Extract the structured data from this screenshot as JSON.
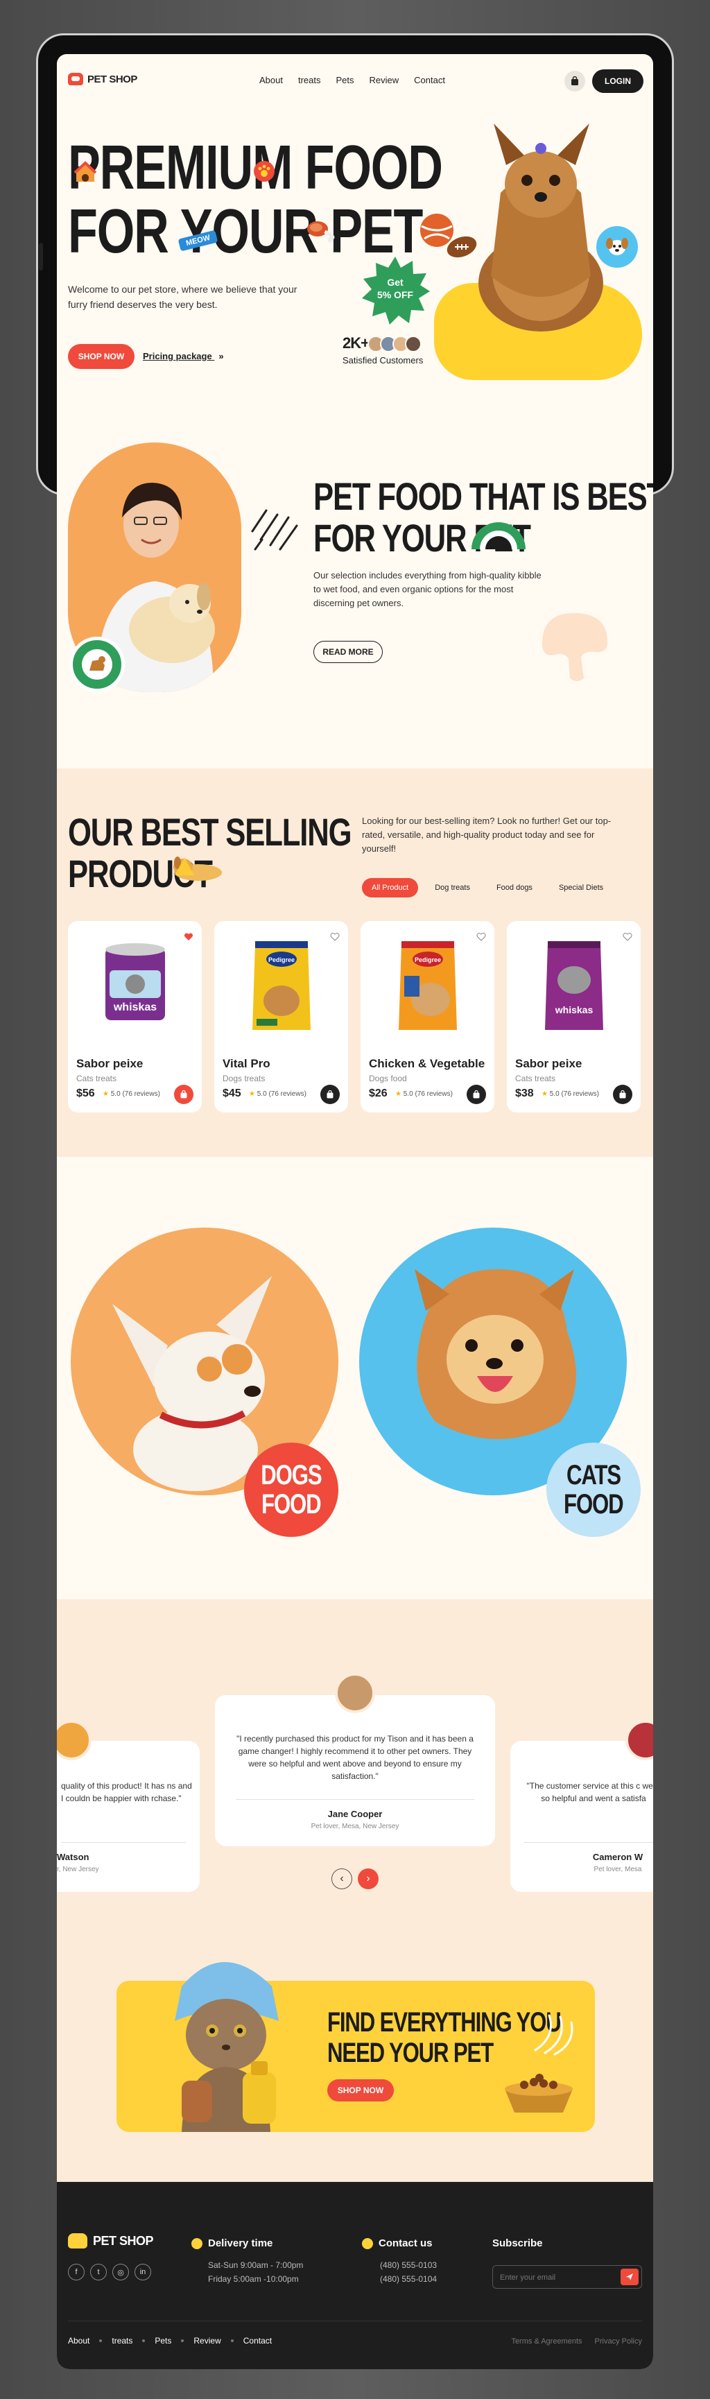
{
  "brand": {
    "name": "PET SHOP",
    "accent": "#ef4a3b",
    "yellow": "#ffd22e",
    "dark": "#1c1c1c"
  },
  "nav": {
    "links": [
      "About",
      "treats",
      "Pets",
      "Review",
      "Contact"
    ],
    "login": "LOGIN",
    "cart_icon": "shopping-bag-icon"
  },
  "hero": {
    "title_line1": "PREMIUM FOOD",
    "title_line2": "FOR YOUR PET",
    "tag": "MEOW",
    "description": "Welcome to our pet store, where we believe that your furry friend deserves the very best.",
    "cta": "SHOP NOW",
    "pricing_link": "Pricing package",
    "offer_line1": "Get",
    "offer_line2": "5% OFF",
    "customers_count": "2K+",
    "customers_label": "Satisfied Customers"
  },
  "about": {
    "title_line1": "PET FOOD THAT IS BEST",
    "title_line2": "FOR YOUR PET",
    "description": "Our selection includes everything from high-quality kibble to wet food, and even organic options for the most discerning pet owners.",
    "button": "READ MORE"
  },
  "products": {
    "title_line1": "OUR BEST SELLING",
    "title_line2": "PRODUCT",
    "description": "Looking for our best-selling item? Look no further! Get our top-rated, versatile, and high-quality product today and see for yourself!",
    "filters": [
      "All Product",
      "Dog treats",
      "Food dogs",
      "Special Diets"
    ],
    "active_filter": "All Product",
    "items": [
      {
        "name": "Sabor peixe",
        "category": "Cats treats",
        "price": "$56",
        "rating": "5.0",
        "reviews": "(76 reviews)",
        "brand": "whiskas",
        "liked": true
      },
      {
        "name": "Vital Pro",
        "category": "Dogs treats",
        "price": "$45",
        "rating": "5.0",
        "reviews": "(76 reviews)",
        "brand": "Pedigree",
        "liked": false
      },
      {
        "name": "Chicken & Vegetable",
        "category": "Dogs food",
        "price": "$26",
        "rating": "5.0",
        "reviews": "(76 reviews)",
        "brand": "Pedigree",
        "liked": false
      },
      {
        "name": "Sabor peixe",
        "category": "Cats treats",
        "price": "$38",
        "rating": "5.0",
        "reviews": "(76 reviews)",
        "brand": "whiskas",
        "liked": false
      }
    ]
  },
  "categories": {
    "dogs_line1": "DOGS",
    "dogs_line2": "FOOD",
    "cats_line1": "CATS",
    "cats_line2": "FOOD"
  },
  "testimonials": {
    "center": {
      "quote": "\"I recently purchased this product for my Tison and it has been a game changer! I highly recommend it to other pet owners. They were so helpful and went above and beyond to ensure my satisfaction.\"",
      "name": "Jane Cooper",
      "role": "Pet lover, Mesa, New Jersey"
    },
    "left": {
      "quote": "quality of this product! It has ns and I couldn be happier with rchase.\"",
      "name": "Watson",
      "role": "r, New Jersey"
    },
    "right": {
      "quote": "\"The customer service at this c were so helpful and went a satisfa",
      "name": "Cameron W",
      "role": "Pet lover, Mesa"
    }
  },
  "promo": {
    "title_line1": "FIND EVERYTHING YOU",
    "title_line2": "NEED YOUR PET",
    "cta": "SHOP NOW"
  },
  "footer": {
    "brand": "PET SHOP",
    "delivery_title": "Delivery time",
    "delivery_line1": "Sat-Sun 9:00am - 7:00pm",
    "delivery_line2": "Friday 5:00am -10:00pm",
    "contact_title": "Contact us",
    "phone1": "(480) 555-0103",
    "phone2": "(480) 555-0104",
    "subscribe_title": "Subscribe",
    "email_placeholder": "Enter your email",
    "links": [
      "About",
      "treats",
      "Pets",
      "Review",
      "Contact"
    ],
    "legal1": "Terms & Agreements",
    "legal2": "Privacy Policy",
    "socials": [
      "f",
      "t",
      "◎",
      "in"
    ]
  }
}
